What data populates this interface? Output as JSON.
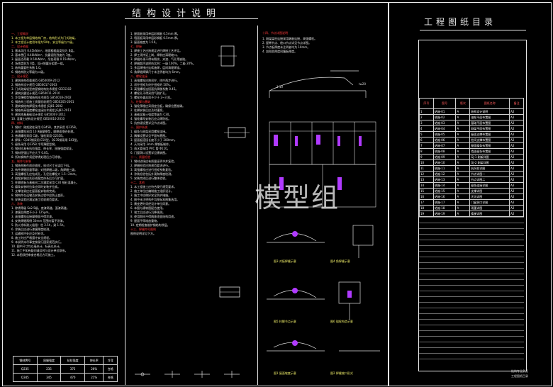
{
  "drawing": {
    "main_title": "结构设计说明",
    "index_title": "工程图纸目录",
    "watermark": "模型组",
    "signoff_line1": "结构专业负责",
    "signoff_line2": "工程图纸目录"
  },
  "column1": {
    "lines": [
      {
        "t": "一、工程概况",
        "c": "red"
      },
      {
        "t": "1. 本工程为单层钢结构厂房，结构形式为门式刚架。",
        "c": "yellow"
      },
      {
        "t": "2. 本工程设计使用年限为50年，安全等级为二级。",
        "c": "yellow"
      },
      {
        "t": "二、设计依据",
        "c": "red"
      },
      {
        "t": "1. 基本风压 0.45kN/m²，地面粗糙度类别为 B类。",
        "c": "white"
      },
      {
        "t": "2. 基本雪压 0.40kN/m²，抗震设防烈度为 7度。",
        "c": "white"
      },
      {
        "t": "3. 屋面活荷载 0.50kN/m²，吊挂荷载 0.15kN/m²。",
        "c": "white"
      },
      {
        "t": "4. 场地类别为 II类，设计地震分组第一组。",
        "c": "white"
      },
      {
        "t": "5. 结构重要性系数 1.0。",
        "c": "white"
      },
      {
        "t": "6. 钢结构防火等级为二级。",
        "c": "white"
      },
      {
        "t": "三、设计规范",
        "c": "red"
      },
      {
        "t": "1. 建筑结构荷载规范 GB50009-2012",
        "c": "white"
      },
      {
        "t": "2. 钢结构设计规范 GB50017-2003",
        "c": "white"
      },
      {
        "t": "3. 门式刚架轻型房屋钢结构技术规程 CECS102",
        "c": "white"
      },
      {
        "t": "4. 建筑抗震设计规范 GB50011-2010",
        "c": "white"
      },
      {
        "t": "5. 冷弯薄壁型钢结构技术规范 GB50018-2002",
        "c": "white"
      },
      {
        "t": "6. 钢结构工程施工质量验收规范 GB50205-2001",
        "c": "white"
      },
      {
        "t": "7. 建筑钢结构焊接技术规程 JGJ81-2002",
        "c": "white"
      },
      {
        "t": "8. 钢结构高强度螺栓连接技术规程 JGJ82-2011",
        "c": "white"
      },
      {
        "t": "9. 建筑地基基础设计规范 GB50007-2011",
        "c": "white"
      },
      {
        "t": "10. 混凝土结构设计规范 GB50010-2010",
        "c": "white"
      },
      {
        "t": "四、材料",
        "c": "red"
      },
      {
        "t": "1. 钢材：刚架梁柱采用 Q345B，其余采用 Q235B。",
        "c": "white"
      },
      {
        "t": "2. 高强螺栓采用 10.9级摩擦型，摩擦面喷砂处理。",
        "c": "white"
      },
      {
        "t": "3. 普通螺栓采用 C级，锚栓采用 Q235B。",
        "c": "white"
      },
      {
        "t": "4. 焊条：Q345钢采用 E50型，Q235钢采用 E43型。",
        "c": "white"
      },
      {
        "t": "5. 檩条采用 Q235B 冷弯薄壁型钢。",
        "c": "white"
      },
      {
        "t": "6. 钢材应具有抗拉强度、伸长率、屈服强度保证。",
        "c": "white"
      },
      {
        "t": "7. 钢材屈强比不应大于 0.85。",
        "c": "white"
      },
      {
        "t": "8. 所有钢构件须经除锈处理后方可涂装。",
        "c": "white"
      },
      {
        "t": "五、制作与安装",
        "c": "red"
      },
      {
        "t": "1. 钢结构制作前应放样，核对尺寸无误后下料。",
        "c": "white"
      },
      {
        "t": "2. 构件焊缝质量等级：对接焊缝二级，角焊缝三级。",
        "c": "white"
      },
      {
        "t": "3. 高强螺栓孔应钻成孔，孔径比螺栓大 1.5~2mm。",
        "c": "white"
      },
      {
        "t": "4. 刚架安装应先形成稳定体系后方可扩展。",
        "c": "white"
      },
      {
        "t": "5. 柱脚底板与基础间二次灌浆采用 C30 细石混凝土。",
        "c": "white"
      },
      {
        "t": "6. 檩条安装时拉条应同时安装并拉紧。",
        "c": "white"
      },
      {
        "t": "7. 支撑张紧应在屋面板安装前完成。",
        "c": "white"
      },
      {
        "t": "8. 钢构件在运输及安装过程中应防止变形。",
        "c": "white"
      },
      {
        "t": "9. 安装误差应满足施工验收规范要求。",
        "c": "white"
      },
      {
        "t": "六、涂装",
        "c": "red"
      },
      {
        "t": "1. 除锈等级 Sa2.5级，底漆两道，面漆两道。",
        "c": "white"
      },
      {
        "t": "2. 漆膜总厚度不小于 125μm。",
        "c": "white"
      },
      {
        "t": "3. 高强螺栓连接摩擦面不得涂漆。",
        "c": "white"
      },
      {
        "t": "4. 安装焊缝两侧 50mm 范围内暂不涂漆。",
        "c": "white"
      },
      {
        "t": "5. 防火涂料耐火极限：柱 2.5h，梁 1.5h。",
        "c": "white"
      },
      {
        "t": "6. 涂装后应进行漆膜厚度检测。",
        "c": "white"
      },
      {
        "t": "7. 运输损坏处应及时补涂。",
        "c": "white"
      },
      {
        "t": "8. 施工时应严格遵守安全规程。",
        "c": "white"
      },
      {
        "t": "9. 本说明未尽事宜按现行国家规范执行。",
        "c": "white"
      },
      {
        "t": "10. 图中尺寸均以毫米计，标高以米计。",
        "c": "white"
      },
      {
        "t": "11. 施工中如有疑问请及时与设计单位联系。",
        "c": "white"
      },
      {
        "t": "12. 本图须经审查合格后方可施工。",
        "c": "white"
      }
    ],
    "table": {
      "rows": [
        [
          "钢材牌号",
          "屈服强度",
          "抗拉强度",
          "伸长率",
          "冷弯"
        ],
        [
          "Q235",
          "235",
          "375",
          "26%",
          "合格"
        ],
        [
          "Q345",
          "345",
          "470",
          "21%",
          "合格"
        ]
      ]
    }
  },
  "column2": {
    "lines": [
      {
        "t": "1. 屋面板采用单层彩钢板 0.5mm 厚。",
        "c": "white"
      },
      {
        "t": "2. 墙面板采用单层彩钢板 0.5mm 厚。",
        "c": "white"
      },
      {
        "t": "3. 屋面坡度为 1:10。",
        "c": "white"
      },
      {
        "t": "七、焊接",
        "c": "red"
      },
      {
        "t": "1. 焊接工艺应按规定进行焊接工艺评定。",
        "c": "white"
      },
      {
        "t": "2. 焊工须持证上岗，焊前应清理坡口。",
        "c": "white"
      },
      {
        "t": "3. 焊缝外观不得有裂纹、夹渣、气孔等缺陷。",
        "c": "white"
      },
      {
        "t": "4. 焊缝超声波探伤比例：一级 100%，二级 20%。",
        "c": "white"
      },
      {
        "t": "5. 多层焊接应连续施焊，层间清理焊渣。",
        "c": "white"
      },
      {
        "t": "6. 角焊缝焊脚尺寸未注明者均为 6mm。",
        "c": "white"
      },
      {
        "t": "八、螺栓连接",
        "c": "red"
      },
      {
        "t": "1. 高强螺栓应按初拧、终拧两步进行。",
        "c": "white"
      },
      {
        "t": "2. 初拧扭矩为终拧扭矩的 50%。",
        "c": "white"
      },
      {
        "t": "3. 高强螺栓连接面抗滑移系数 0.45。",
        "c": "white"
      },
      {
        "t": "4. 螺栓孔不得采用气割扩孔。",
        "c": "white"
      },
      {
        "t": "5. 螺栓外露丝扣不少于 2~3 扣。",
        "c": "white"
      },
      {
        "t": "九、柱脚与基础",
        "c": "red"
      },
      {
        "t": "1. 锚栓预埋应采用定位板，确保位置准确。",
        "c": "white"
      },
      {
        "t": "2. 柱脚安装后应及时灌浆。",
        "c": "white"
      },
      {
        "t": "3. 基础混凝土强度等级为 C30。",
        "c": "white"
      },
      {
        "t": "4. 锚栓螺母安装后应点焊防松。",
        "c": "white"
      },
      {
        "t": "5. 抗剪键设置详见节点详图。",
        "c": "white"
      },
      {
        "t": "十、围护系统",
        "c": "red"
      },
      {
        "t": "1. 檩条与刚架采用螺栓连接。",
        "c": "white"
      },
      {
        "t": "2. 隅撑设置详见平面布置图。",
        "c": "white"
      },
      {
        "t": "3. 屋面板搭接长度不小于 200mm。",
        "c": "white"
      },
      {
        "t": "4. 天沟采用 3mm 厚钢板制作。",
        "c": "white"
      },
      {
        "t": "5. 雨水管采用 PVC 管 Φ110。",
        "c": "white"
      },
      {
        "t": "6. 门窗洞口设置详见建筑图。",
        "c": "white"
      },
      {
        "t": "十一、质量检验",
        "c": "red"
      },
      {
        "t": "1. 钢材进场应有质量证明书并复验。",
        "c": "white"
      },
      {
        "t": "2. 焊缝检验应按规范要求进行。",
        "c": "white"
      },
      {
        "t": "3. 高强螺栓应进行扭矩系数复验。",
        "c": "white"
      },
      {
        "t": "4. 涂装检验包括外观和厚度检测。",
        "c": "white"
      },
      {
        "t": "5. 安装完成后进行整体验收。",
        "c": "white"
      },
      {
        "t": "十二、其他",
        "c": "red"
      },
      {
        "t": "1. 本工程施工应符合现行规范要求。",
        "c": "white"
      },
      {
        "t": "2. 施工单位应编制施工组织设计。",
        "c": "white"
      },
      {
        "t": "3. 施工中应做好安全防护措施。",
        "c": "white"
      },
      {
        "t": "4. 图中未注明构件均按标准图集选用。",
        "c": "white"
      },
      {
        "t": "5. 需变更时须经设计单位同意。",
        "c": "white"
      },
      {
        "t": "6. 本图与建筑图配合使用。",
        "c": "white"
      },
      {
        "t": "7. 竣工后应进行沉降观测。",
        "c": "white"
      },
      {
        "t": "8. 使用期间不得随意改变结构用途。",
        "c": "white"
      },
      {
        "t": "9. 屋面不得堆放重物。",
        "c": "white"
      },
      {
        "t": "10. 定期检查维护钢结构涂层。",
        "c": "white"
      },
      {
        "t": "十三、焊缝符号图例",
        "c": "red"
      },
      {
        "t": "图例说明详见下方。",
        "c": "white"
      }
    ]
  },
  "column3": {
    "heading": "十四、节点详图说明",
    "lines": [
      {
        "t": "1. 刚架梁柱连接采用端板连接，高强螺栓。",
        "c": "white"
      },
      {
        "t": "2. 屋脊节点、檐口节点详见节点详图。",
        "c": "white"
      },
      {
        "t": "3. 节点板厚度未注明者均为 10mm。",
        "c": "white"
      },
      {
        "t": "4. 加劲肋厚度同腹板厚度。",
        "c": "white"
      }
    ],
    "caption1": "图1 屋面坡度示意",
    "caption2": "图2 焊缝坡口形式",
    "caption3": "图3 对接焊缝示意",
    "caption4": "图4 角焊缝示意",
    "caption5": "图5 柱脚节点示意",
    "caption6": "图6 锚栓构造示意",
    "label_slope": "1:10",
    "label_gap": "t≥20"
  },
  "index": {
    "headers": [
      "序号",
      "图号",
      "版次",
      "图纸名称",
      "备注"
    ],
    "rows": [
      [
        "1",
        "结施-01",
        "A",
        "结构设计说明",
        "A2"
      ],
      [
        "2",
        "结施-02",
        "A",
        "锚栓平面布置图",
        "A2"
      ],
      [
        "3",
        "结施-03",
        "A",
        "基础平面布置图",
        "A2"
      ],
      [
        "4",
        "结施-04",
        "A",
        "刚架平面布置图",
        "A2"
      ],
      [
        "5",
        "结施-05",
        "A",
        "屋面支撑布置图",
        "A2"
      ],
      [
        "6",
        "结施-06",
        "A",
        "柱间支撑布置图",
        "A2"
      ],
      [
        "7",
        "结施-07",
        "A",
        "屋面檩条布置图",
        "A2"
      ],
      [
        "8",
        "结施-08",
        "A",
        "墙面檩条布置图",
        "A2"
      ],
      [
        "9",
        "结施-09",
        "A",
        "GJ-1 刚架详图",
        "A2"
      ],
      [
        "10",
        "结施-10",
        "A",
        "GJ-2 刚架详图",
        "A2"
      ],
      [
        "11",
        "结施-11",
        "A",
        "抗风柱详图",
        "A2"
      ],
      [
        "12",
        "结施-12",
        "A",
        "节点详图一",
        "A2"
      ],
      [
        "13",
        "结施-13",
        "A",
        "节点详图二",
        "A2"
      ],
      [
        "14",
        "结施-14",
        "A",
        "檩条连接详图",
        "A2"
      ],
      [
        "15",
        "结施-15",
        "A",
        "支撑详图",
        "A2"
      ],
      [
        "16",
        "结施-16",
        "A",
        "天沟详图",
        "A2"
      ],
      [
        "17",
        "结施-17",
        "A",
        "门窗洞口详图",
        "A2"
      ],
      [
        "18",
        "结施-18",
        "A",
        "雨篷详图",
        "A2"
      ],
      [
        "19",
        "结施-19",
        "A",
        "楼梯详图",
        "A2"
      ]
    ]
  }
}
